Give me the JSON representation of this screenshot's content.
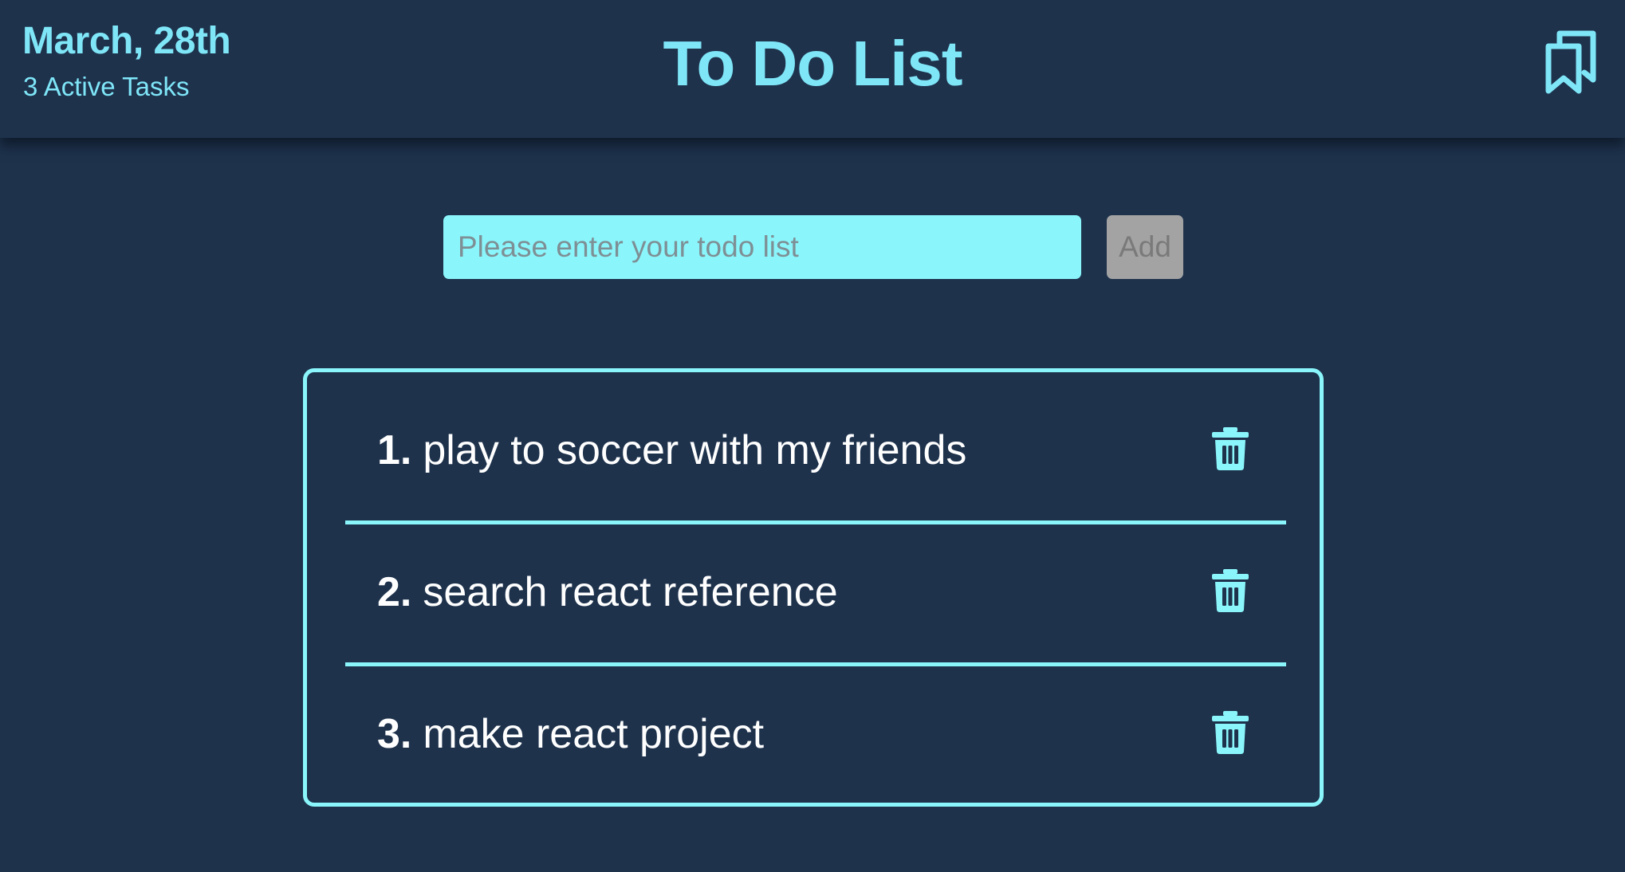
{
  "header": {
    "date": "March, 28th",
    "active_tasks": "3 Active Tasks",
    "title": "To Do List",
    "bookmark_icon": "bookmark-icon"
  },
  "form": {
    "placeholder": "Please enter your todo list",
    "value": "",
    "add_label": "Add"
  },
  "todos": [
    {
      "number": "1.",
      "text": "play to soccer with my friends",
      "icon": "trash-icon"
    },
    {
      "number": "2.",
      "text": "search react reference",
      "icon": "trash-icon"
    },
    {
      "number": "3.",
      "text": "make react project",
      "icon": "trash-icon"
    }
  ],
  "colors": {
    "background": "#1e324c",
    "accent": "#8af6fb",
    "header_text": "#7fe6f8",
    "item_text": "#ffffff",
    "disabled_button": "#a3a3a3"
  }
}
